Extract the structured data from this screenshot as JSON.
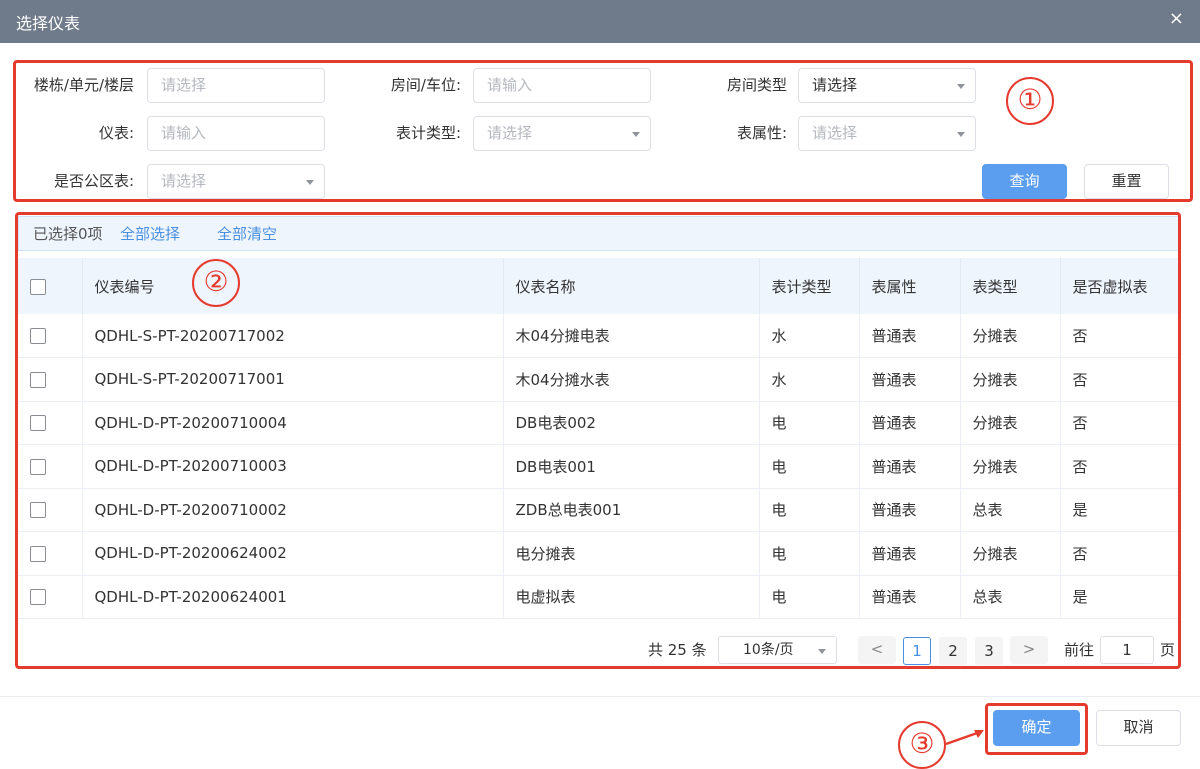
{
  "dialog": {
    "title": "选择仪表",
    "close_glyph": "×"
  },
  "filters": {
    "building_label": "楼栋/单元/楼层",
    "building_placeholder": "请选择",
    "room_label": "房间/车位:",
    "room_placeholder": "请输入",
    "room_type_label": "房间类型",
    "room_type_value": "请选择",
    "meter_label": "仪表:",
    "meter_placeholder": "请输入",
    "meter_type_label": "表计类型:",
    "meter_type_placeholder": "请选择",
    "attr_label": "表属性:",
    "attr_placeholder": "请选择",
    "public_label": "是否公区表:",
    "public_placeholder": "请选择",
    "query_button": "查询",
    "reset_button": "重置"
  },
  "selection": {
    "count_text": "已选择0项",
    "select_all": "全部选择",
    "clear_all": "全部清空"
  },
  "table": {
    "headers": [
      "仪表编号",
      "仪表名称",
      "表计类型",
      "表属性",
      "表类型",
      "是否虚拟表"
    ],
    "rows": [
      [
        "QDHL-S-PT-20200717002",
        "木04分摊电表",
        "水",
        "普通表",
        "分摊表",
        "否"
      ],
      [
        "QDHL-S-PT-20200717001",
        "木04分摊水表",
        "水",
        "普通表",
        "分摊表",
        "否"
      ],
      [
        "QDHL-D-PT-20200710004",
        "DB电表002",
        "电",
        "普通表",
        "分摊表",
        "否"
      ],
      [
        "QDHL-D-PT-20200710003",
        "DB电表001",
        "电",
        "普通表",
        "分摊表",
        "否"
      ],
      [
        "QDHL-D-PT-20200710002",
        "ZDB总电表001",
        "电",
        "普通表",
        "总表",
        "是"
      ],
      [
        "QDHL-D-PT-20200624002",
        "电分摊表",
        "电",
        "普通表",
        "分摊表",
        "否"
      ],
      [
        "QDHL-D-PT-20200624001",
        "电虚拟表",
        "电",
        "普通表",
        "总表",
        "是"
      ]
    ]
  },
  "pagination": {
    "total_text": "共 25 条",
    "page_size": "10条/页",
    "prev_glyph": "<",
    "next_glyph": ">",
    "pages": [
      "1",
      "2",
      "3"
    ],
    "current_page": "1",
    "goto_label": "前往",
    "goto_value": "1",
    "goto_suffix": "页"
  },
  "footer": {
    "confirm_button": "确定",
    "cancel_button": "取消"
  },
  "annotations": {
    "marker_1": "①",
    "marker_2": "②",
    "marker_3": "③"
  },
  "colors": {
    "titlebar": "#6f7b8a",
    "primary": "#5b9ef0",
    "annotation_red": "#e53b2f",
    "link": "#4a90e2"
  }
}
